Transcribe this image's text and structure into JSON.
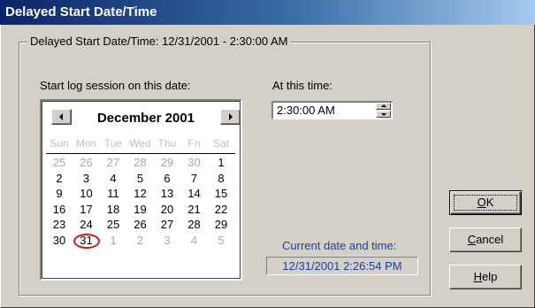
{
  "window": {
    "title": "Delayed Start Date/Time"
  },
  "group": {
    "legend": "Delayed Start Date/Time: 12/31/2001 - 2:30:00 AM"
  },
  "date_label": "Start log session on this date:",
  "time_label": "At this time:",
  "calendar": {
    "month_year": "December 2001",
    "prev_icon": "left-arrow-icon",
    "next_icon": "right-arrow-icon",
    "weekdays": [
      "Sun",
      "Mon",
      "Tue",
      "Wed",
      "Thu",
      "Fri",
      "Sat"
    ],
    "weeks": [
      [
        {
          "d": "25",
          "o": true
        },
        {
          "d": "26",
          "o": true
        },
        {
          "d": "27",
          "o": true
        },
        {
          "d": "28",
          "o": true
        },
        {
          "d": "29",
          "o": true
        },
        {
          "d": "30",
          "o": true
        },
        {
          "d": "1",
          "o": false
        }
      ],
      [
        {
          "d": "2",
          "o": false
        },
        {
          "d": "3",
          "o": false
        },
        {
          "d": "4",
          "o": false
        },
        {
          "d": "5",
          "o": false
        },
        {
          "d": "6",
          "o": false
        },
        {
          "d": "7",
          "o": false
        },
        {
          "d": "8",
          "o": false
        }
      ],
      [
        {
          "d": "9",
          "o": false
        },
        {
          "d": "10",
          "o": false
        },
        {
          "d": "11",
          "o": false
        },
        {
          "d": "12",
          "o": false
        },
        {
          "d": "13",
          "o": false
        },
        {
          "d": "14",
          "o": false
        },
        {
          "d": "15",
          "o": false
        }
      ],
      [
        {
          "d": "16",
          "o": false
        },
        {
          "d": "17",
          "o": false
        },
        {
          "d": "18",
          "o": false
        },
        {
          "d": "19",
          "o": false
        },
        {
          "d": "20",
          "o": false
        },
        {
          "d": "21",
          "o": false
        },
        {
          "d": "22",
          "o": false
        }
      ],
      [
        {
          "d": "23",
          "o": false
        },
        {
          "d": "24",
          "o": false
        },
        {
          "d": "25",
          "o": false
        },
        {
          "d": "26",
          "o": false
        },
        {
          "d": "27",
          "o": false
        },
        {
          "d": "28",
          "o": false
        },
        {
          "d": "29",
          "o": false
        }
      ],
      [
        {
          "d": "30",
          "o": false
        },
        {
          "d": "31",
          "o": false
        },
        {
          "d": "1",
          "o": true
        },
        {
          "d": "2",
          "o": true
        },
        {
          "d": "3",
          "o": true
        },
        {
          "d": "4",
          "o": true
        },
        {
          "d": "5",
          "o": true
        }
      ]
    ],
    "selected_day": "31",
    "today_marker_color": "#e01010"
  },
  "time_picker": {
    "value": "2:30:00 AM",
    "up_icon": "spin-up-icon",
    "down_icon": "spin-down-icon"
  },
  "current": {
    "label": "Current date and time:",
    "value": "12/31/2001 2:26:54 PM"
  },
  "buttons": {
    "ok": {
      "underline": "O",
      "rest": "K"
    },
    "cancel": {
      "underline": "C",
      "rest": "ancel"
    },
    "help": {
      "underline": "H",
      "rest": "elp"
    }
  },
  "colors": {
    "title_bar": "#0a246a",
    "face": "#d4d0c8",
    "info_text": "#1a3ea8"
  }
}
